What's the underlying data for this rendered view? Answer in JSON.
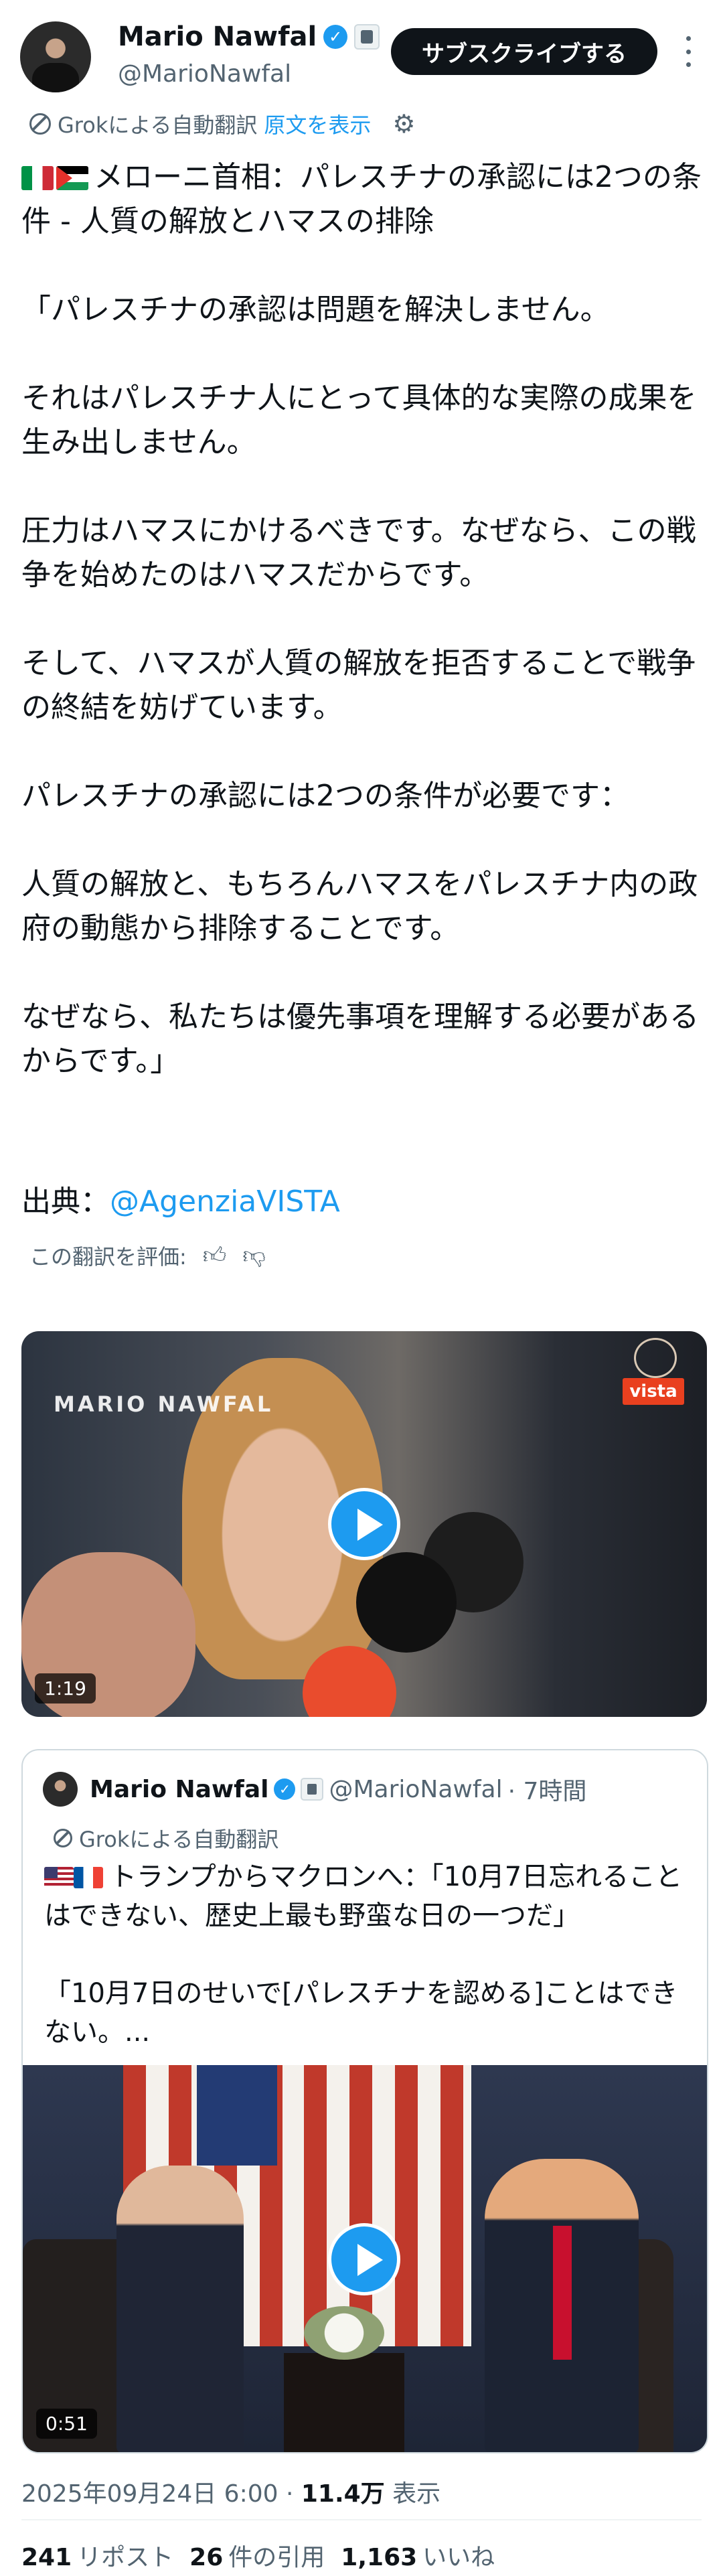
{
  "author": {
    "name": "Mario Nawfal",
    "handle": "@MarioNawfal",
    "verified_icon": "verified-badge-icon",
    "affiliation_icon": "affiliation-badge-icon"
  },
  "header": {
    "subscribe_label": "サブスクライブする"
  },
  "translation": {
    "label": "Grokによる自動翻訳",
    "show_original": "原文を表示"
  },
  "post": {
    "body": "メローニ首相：パレスチナの承認には2つの条件 - 人質の解放とハマスの排除\n\n「パレスチナの承認は問題を解決しません。\n\nそれはパレスチナ人にとって具体的な実際の成果を生み出しません。\n\n圧力はハマスにかけるべきです。なぜなら、この戦争を始めたのはハマスだからです。\n\nそして、ハマスが人質の解放を拒否することで戦争の終結を妨げています。\n\nパレスチナの承認には2つの条件が必要です：\n\n人質の解放と、もちろんハマスをパレスチナ内の政府の動態から排除することです。\n\nなぜなら、私たちは優先事項を理解する必要があるからです。」",
    "source_label": "出典：",
    "source_link": "@AgenziaVISTA",
    "rate_label": "この翻訳を評価:"
  },
  "video1": {
    "duration": "1:19",
    "watermark": "MARIO NAWFAL",
    "logo_text": "vista"
  },
  "quote": {
    "name": "Mario Nawfal",
    "handle": "@MarioNawfal",
    "time": "· 7時間",
    "translation_label": "Grokによる自動翻訳",
    "text": "トランプからマクロンへ：「10月7日忘れることはできない、歴史上最も野蛮な日の一つだ」\n\n「10月7日のせいで[パレスチナを認める]ことはできない。...",
    "video_duration": "0:51"
  },
  "footer": {
    "timestamp": "2025年09月24日 6:00 · ",
    "views_count": "11.4万",
    "views_label": " 表示",
    "reposts_count": "241",
    "reposts_label": "リポスト",
    "quotes_count": "26",
    "quotes_label": "件の引用",
    "likes_count": "1,163",
    "likes_label": "いいね"
  }
}
